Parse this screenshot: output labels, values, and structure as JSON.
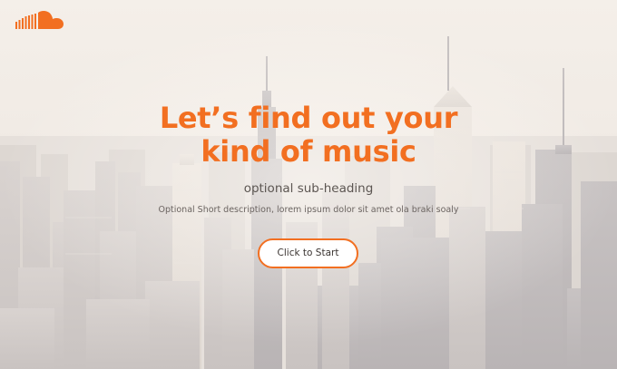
{
  "hero": {
    "headline": "Let’s find out your\nkind of music",
    "subheading": "optional sub-heading",
    "description": "Optional Short description, lorem ipsum dolor sit amet ola braki soaly",
    "cta_label": "Click to Start"
  },
  "brand": {
    "logo_icon": "soundcloud-logo-icon",
    "accent_color": "#f26f21"
  },
  "background": {
    "image_subject": "city-skyline-photo"
  }
}
